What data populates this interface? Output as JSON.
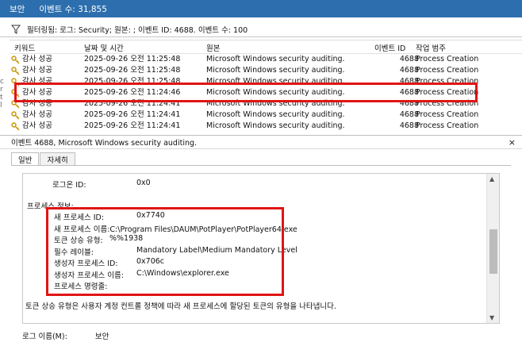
{
  "titlebar": {
    "log_name": "보안",
    "event_count": "이벤트 수: 31,855"
  },
  "filter": {
    "text": "필터링됨: 로그: Security; 원본: ; 이벤트 ID: 4688. 이벤트 수: 100"
  },
  "grid": {
    "headers": [
      "키워드",
      "날짜 및 시간",
      "원본",
      "이벤트 ID",
      "작업 범주"
    ],
    "rows": [
      [
        "감사 성공",
        "2025-09-26 오전 11:25:48",
        "Microsoft Windows security auditing.",
        "4688",
        "Process Creation"
      ],
      [
        "감사 성공",
        "2025-09-26 오전 11:25:48",
        "Microsoft Windows security auditing.",
        "4688",
        "Process Creation"
      ],
      [
        "감사 성공",
        "2025-09-26 오전 11:25:48",
        "Microsoft Windows security auditing.",
        "4688",
        "Process Creation"
      ],
      [
        "감사 성공",
        "2025-09-26 오전 11:24:46",
        "Microsoft Windows security auditing.",
        "4688",
        "Process Creation"
      ],
      [
        "감사 성공",
        "2025-09-26 오전 11:24:41",
        "Microsoft Windows security auditing.",
        "4688",
        "Process Creation"
      ],
      [
        "감사 성공",
        "2025-09-26 오전 11:24:41",
        "Microsoft Windows security auditing.",
        "4688",
        "Process Creation"
      ],
      [
        "감사 성공",
        "2025-09-26 오전 11:24:41",
        "Microsoft Windows security auditing.",
        "4688",
        "Process Creation"
      ]
    ]
  },
  "detail": {
    "title": "이벤트 4688, Microsoft Windows security auditing.",
    "close": "×",
    "tabs": [
      "일반",
      "자세히"
    ],
    "logon_id_label": "로그온 ID:",
    "logon_id_value": "0x0",
    "process_info_label": "프로세스 정보:",
    "fields": [
      {
        "label": "새 프로세스 ID:",
        "value": "0x7740"
      },
      {
        "label": "새 프로세스 이름:",
        "value": "C:\\Program Files\\DAUM\\PotPlayer\\PotPlayer64.exe"
      },
      {
        "label": "토큰 상승 유형:",
        "value": "%%1938"
      },
      {
        "label": "필수 레이블:",
        "value": "Mandatory Label\\Medium Mandatory Level"
      },
      {
        "label": "생성자 프로세스 ID:",
        "value": "0x706c"
      },
      {
        "label": "생성자 프로세스 이름:",
        "value": "C:\\Windows\\explorer.exe"
      },
      {
        "label": "프로세스 명령줄:",
        "value": ""
      }
    ],
    "token_note": "토큰 상승 유형은 사용자 계정 컨트롤 정책에 따라 새 프로세스에 할당된 토큰의 유형을 나타냅니다.",
    "log_name_label": "로그 이름(M):",
    "log_name_value": "보안"
  },
  "colors": {
    "titlebar": "#2d6fae",
    "highlight": "#e01515"
  }
}
